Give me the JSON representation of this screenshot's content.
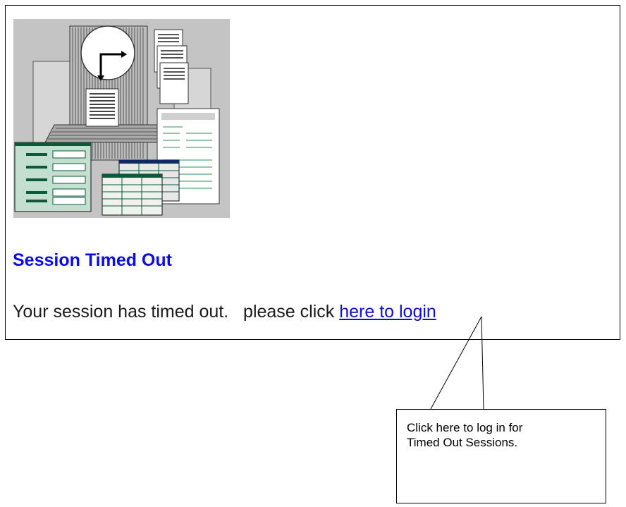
{
  "session": {
    "title": "Session Timed Out",
    "message_prefix": "Your session has timed out.   please click ",
    "login_link_label": "here to login"
  },
  "callout": {
    "line1": "Click here to log in for",
    "line2": "Timed Out Sessions."
  },
  "colors": {
    "title": "#0b0bea",
    "link": "#1010c8",
    "illustration_bg": "#c4c4c4",
    "form_green": "#c3dfcf",
    "form_header": "#0d5a3a"
  }
}
